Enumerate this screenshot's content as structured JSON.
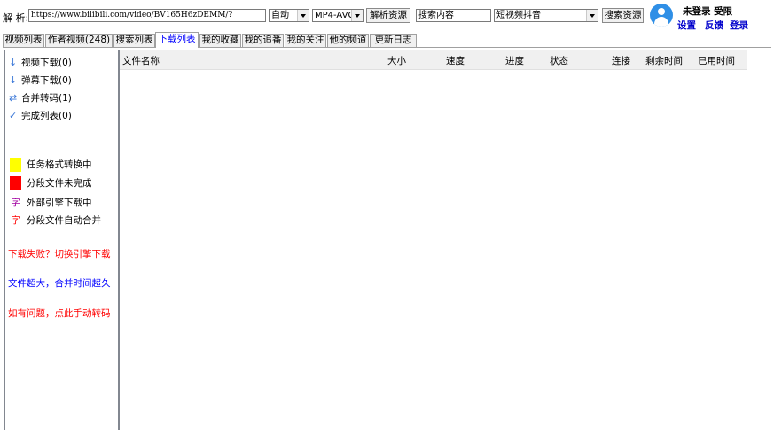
{
  "toolbar": {
    "parse_label": "解 析:",
    "url_value": "https://www.bilibili.com/video/BV165H6zDEMM/?",
    "quality_select": "自动",
    "codec_select": "MP4-AVC",
    "parse_button": "解析资源",
    "search_placeholder": "搜索内容",
    "search_source_select": "短视频抖音",
    "search_button": "搜索资源"
  },
  "user": {
    "status": "未登录 受限",
    "settings": "设置",
    "feedback": "反馈",
    "login": "登录"
  },
  "tabs": [
    {
      "label": "视频列表"
    },
    {
      "label": "作者视频(248)"
    },
    {
      "label": "搜索列表"
    },
    {
      "label": "下载列表"
    },
    {
      "label": "我的收藏"
    },
    {
      "label": "我的追番"
    },
    {
      "label": "我的关注"
    },
    {
      "label": "他的频道"
    },
    {
      "label": "更新日志"
    }
  ],
  "queue": [
    {
      "icon": "arrow-down-icon",
      "label": "视频下载(0)"
    },
    {
      "icon": "arrow-down-icon",
      "label": "弹幕下载(0)"
    },
    {
      "icon": "merge-arrows-icon",
      "label": "合并转码(1)"
    },
    {
      "icon": "checkmark-icon",
      "label": "完成列表(0)"
    }
  ],
  "legend": [
    {
      "color": "#ffff00",
      "label": "任务格式转换中"
    },
    {
      "color": "#ff0000",
      "label": "分段文件未完成"
    },
    {
      "glyph": "字",
      "label": "外部引擎下载中"
    },
    {
      "glyph": "字",
      "label": "分段文件自动合并"
    }
  ],
  "notes": [
    {
      "label": "下载失败？切换引擎下载",
      "color": "#ff0000"
    },
    {
      "label": "文件超大，合并时间超久",
      "color": "#0000ff"
    },
    {
      "label": "如有问题，点此手动转码",
      "color": "#ff0000"
    }
  ],
  "columns": [
    {
      "label": "文件名称"
    },
    {
      "label": "大小"
    },
    {
      "label": "速度"
    },
    {
      "label": "进度"
    },
    {
      "label": "状态"
    },
    {
      "label": "连接"
    },
    {
      "label": "剩余时间"
    },
    {
      "label": "已用时间"
    }
  ]
}
